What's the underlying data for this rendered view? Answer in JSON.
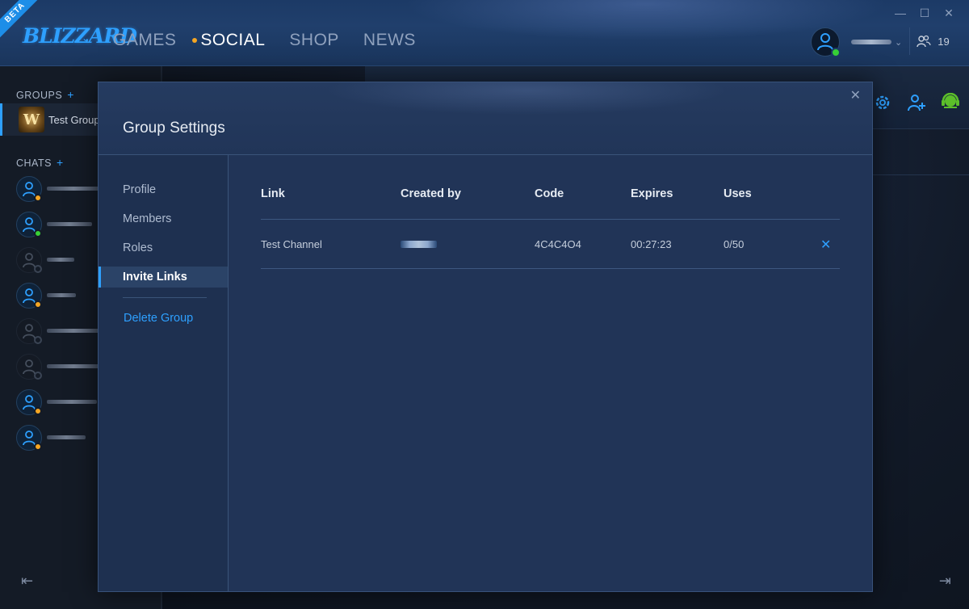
{
  "titlebar": {
    "beta_label": "BETA",
    "logo_text": "BLIZZARD",
    "window_controls": [
      "—",
      "☐",
      "✕"
    ]
  },
  "nav": {
    "items": [
      {
        "label": "GAMES",
        "active": false
      },
      {
        "label": "SOCIAL",
        "active": true,
        "indicator_color": "#f5a623"
      },
      {
        "label": "SHOP",
        "active": false
      },
      {
        "label": "NEWS",
        "active": false
      }
    ]
  },
  "account": {
    "status": "online",
    "status_color": "#37d137",
    "friends_count": "19"
  },
  "sidebar": {
    "groups_title": "GROUPS",
    "chats_title": "CHATS",
    "groups": [
      {
        "label": "Test Group",
        "icon": "warcraft-icon"
      }
    ],
    "chats": [
      {
        "status": "away"
      },
      {
        "status": "online"
      },
      {
        "status": "offline"
      },
      {
        "status": "away"
      },
      {
        "status": "offline"
      },
      {
        "status": "offline"
      },
      {
        "status": "away"
      },
      {
        "status": "away"
      }
    ]
  },
  "modal": {
    "title": "Group Settings",
    "close_label": "✕",
    "nav": {
      "items": [
        {
          "label": "Profile",
          "active": false
        },
        {
          "label": "Members",
          "active": false
        },
        {
          "label": "Roles",
          "active": false
        },
        {
          "label": "Invite Links",
          "active": true
        }
      ],
      "delete_label": "Delete Group"
    },
    "table": {
      "headers": {
        "link": "Link",
        "created_by": "Created by",
        "code": "Code",
        "expires": "Expires",
        "uses": "Uses"
      },
      "rows": [
        {
          "link": "Test Channel",
          "code": "4C4C4O4",
          "expires": "00:27:23",
          "uses": "0/50",
          "revoke_label": "✕"
        }
      ]
    }
  },
  "colors": {
    "accent": "#2ea0ff",
    "online": "#37d137",
    "away": "#f5a623",
    "offline": "#5a6474"
  }
}
